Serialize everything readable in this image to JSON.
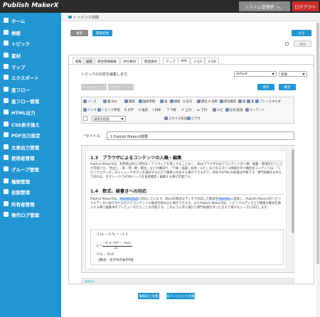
{
  "header": {
    "app_name": "Publish MakerX",
    "user_name": "システム管理者",
    "user_suffix": "さん",
    "logout_label": "ログアウト"
  },
  "sidebar": {
    "items": [
      {
        "label": "ホーム",
        "icon": "home-icon"
      },
      {
        "label": "検索",
        "icon": "search-icon"
      },
      {
        "label": "トピック",
        "icon": "topic-icon"
      },
      {
        "label": "素材",
        "icon": "material-icon"
      },
      {
        "label": "マップ",
        "icon": "map-icon"
      },
      {
        "label": "エクスポート",
        "icon": "export-icon"
      },
      {
        "label": "査フロー",
        "icon": "flow-icon"
      },
      {
        "label": "査フロー管理",
        "icon": "flow-manage-icon"
      },
      {
        "label": "HTML出力",
        "icon": "html-icon"
      },
      {
        "label": "CSS表き換え",
        "icon": "css-icon"
      },
      {
        "label": "PDF出力設定",
        "icon": "pdf-icon"
      },
      {
        "label": "文表出力管理",
        "icon": "doc-output-icon"
      },
      {
        "label": "使用者管理",
        "icon": "user-icon"
      },
      {
        "label": "グループ管理",
        "icon": "group-icon"
      },
      {
        "label": "権限管理",
        "icon": "permission-icon"
      },
      {
        "label": "役割管理",
        "icon": "role-icon"
      },
      {
        "label": "所有者管理",
        "icon": "owner-icon"
      },
      {
        "label": "操作ログ管理",
        "icon": "log-icon"
      }
    ]
  },
  "breadcrumb": {
    "label": "トピック詳細"
  },
  "actions": {
    "copy": "複製",
    "attr_edit": "属性変更",
    "return": "戻る",
    "delete": "削除"
  },
  "tabs": [
    "閲覧",
    "編集",
    "属性情報編集",
    "添付素材",
    "関連素材",
    "マップ",
    "XML",
    "メモA",
    "メモB"
  ],
  "editor": {
    "instruction": "トピックの内容を編集します。",
    "template_select": "default",
    "mode_select": "新規",
    "version_up": "バージョンアップ",
    "revision_up": "リビジョンアップ",
    "save": "保存",
    "confirm": "確定",
    "title_label": "*タイトル：",
    "title_value": "1.Publish MakerX概要"
  },
  "toolbar": {
    "row1": [
      "ソース",
      "書",
      "Doc",
      "置換",
      "図表参照",
      "表",
      "挿絵",
      "Ω 記号",
      "脚注",
      "A 注釈",
      "部注編成",
      "表",
      "表",
      "プレースホルダ"
    ],
    "row2": [
      "リンク",
      "トピック参照",
      "B 太字",
      "S 強調",
      "I 斜体",
      "T 下線",
      "x² 上付",
      "x₂ 下付",
      "ルビ",
      "記号/変換",
      "キーワード"
    ],
    "row3": [
      "通常の段落",
      "スタイル有効",
      "ビデオ"
    ]
  },
  "document": {
    "h13": "1.3　ブラウザによるコンテンツの入稿・編集",
    "p13": "Publish MakerXは、利用者はPCに特別なソフトウェアを導入することなく、Webブラウザのみでコンテンツの入稿・編集・管理を行うことが可能です。「見出し・章・項・節・節注」などの構成や、「下線・強調・斜体・ルビ」などのスタイル情報を持つ構造化コンテンツは、「トピックエディタ」のメニューやボタンを選択するだけで簡単に作成する事ができるので、XMLやHTMLの知識は不要です。専門知識をお持ちであれば、ボタン一つでHTMLソースを直接確認・編集する事が可能です。",
    "h14": "1.4　数式、綾書きへの対応",
    "p14a": "Publish MakerXは、",
    "p14_hl1": "MathML",
    "p14_hl2": "形式",
    "p14b": "に対応しています。Wordの数式エディタで作成した数式を",
    "p14_hl3": "MathML",
    "p14c": "に変換し、Publish MakerXのトピックエディタに貼り付けるだけでコンテンツに数式を組み込む事ができます。またPublish MakerXは、トピックエディタ上で複雑な数式を挿入する事で編集中のプレビューを行うことも可能です。このように可に操から専門知識を持った方まで様々なニーズに対応します。",
    "math1": "3.1x − 0.7y = −1.1",
    "math2_pre": "x =",
    "math2_num": "−b ± √(b² − 4ac)",
    "math2_den": "2a",
    "math3": "CO₂ 、H₂O",
    "math_caption": "【数式・化学式の表示例】"
  },
  "status": {
    "path": "body  p"
  },
  "bottom": {
    "compare": "編集前と比較",
    "compare_prev": "前バージョンと比較"
  }
}
